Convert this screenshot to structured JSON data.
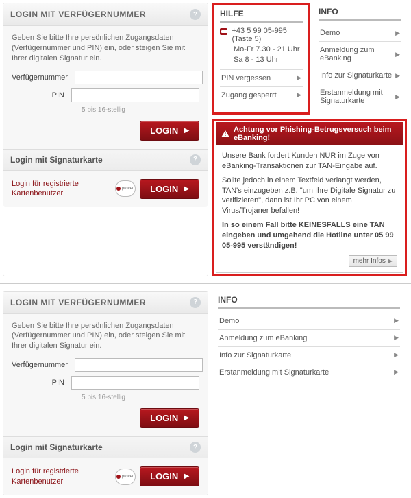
{
  "login": {
    "title": "LOGIN MIT VERFÜGERNUMMER",
    "intro": "Geben Sie bitte Ihre persönlichen Zugangsdaten (Verfügernummer und PIN) ein, oder steigen Sie mit Ihrer digitalen Signatur ein.",
    "field_vn": "Verfügernummer",
    "field_pin": "PIN",
    "pin_hint": "5 bis 16-stellig",
    "button": "LOGIN",
    "sig_title": "Login mit Signaturkarte",
    "sig_link": "Login für registrierte\nKartenbenutzer",
    "proved": "proved"
  },
  "hilfe": {
    "title": "HILFE",
    "phone": "+43 5 99 05-995 (Taste 5)",
    "hours1": "Mo-Fr 7.30 - 21 Uhr",
    "hours2": "Sa 8 - 13 Uhr",
    "links": [
      "PIN vergessen",
      "Zugang gesperrt"
    ]
  },
  "info": {
    "title": "INFO",
    "links": [
      "Demo",
      "Anmeldung zum eBanking",
      "Info zur Signaturkarte",
      "Erstanmeldung mit Signaturkarte"
    ]
  },
  "warn": {
    "title": "Achtung vor Phishing-Betrugsversuch beim eBanking!",
    "p1": "Unsere Bank fordert Kunden NUR im Zuge von eBanking-Transaktionen zur TAN-Eingabe auf.",
    "p2": "Sollte jedoch in einem Textfeld verlangt werden, TAN's einzugeben z.B. \"um Ihre Digitale Signatur zu verifizieren\", dann ist Ihr PC von einem Virus/Trojaner befallen!",
    "p3": "In so einem Fall bitte KEINESFALLS eine TAN eingeben und umgehend die Hotline unter 05 99 05-995 verständigen!",
    "more": "mehr Infos"
  }
}
